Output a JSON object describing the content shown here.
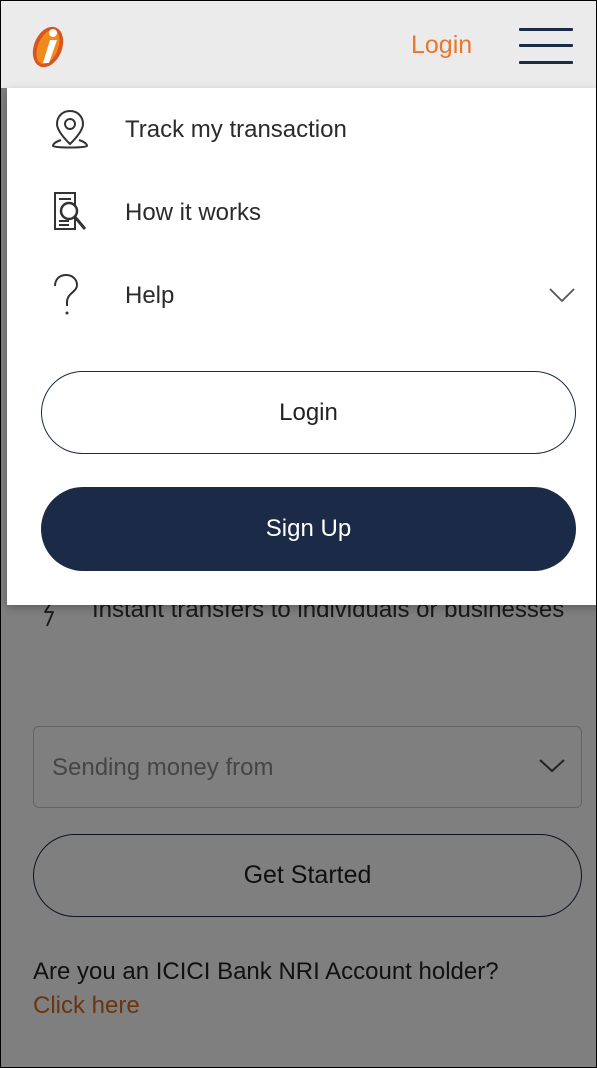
{
  "header": {
    "login_label": "Login",
    "brand_color": "#e8772e"
  },
  "drawer": {
    "items": [
      {
        "label": "Track my transaction",
        "icon": "location-pin-icon"
      },
      {
        "label": "How it works",
        "icon": "document-search-icon"
      },
      {
        "label": "Help",
        "icon": "question-mark-icon",
        "expandable": true
      }
    ],
    "login_label": "Login",
    "signup_label": "Sign Up",
    "button_color": "#1b2a47"
  },
  "page": {
    "feature_text": "Instant transfers to individuals or businesses",
    "country_select": {
      "placeholder": "Sending money from",
      "value": ""
    },
    "get_started_label": "Get Started",
    "nri_question": "Are you an ICICI Bank NRI Account holder?",
    "nri_link": "Click here"
  }
}
